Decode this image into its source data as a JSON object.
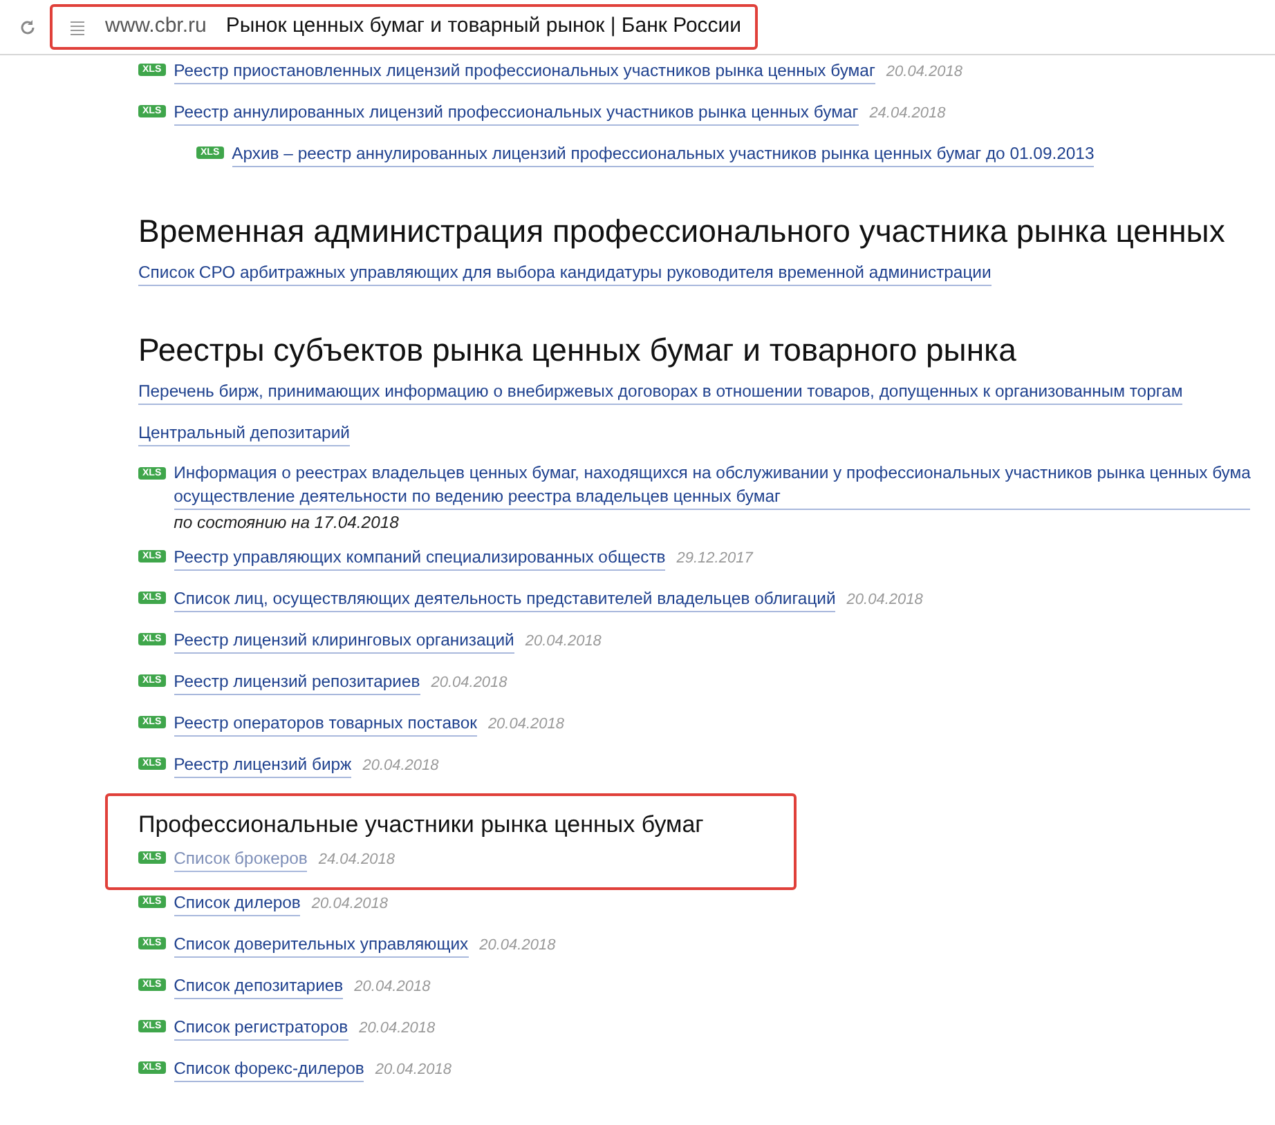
{
  "address_bar": {
    "url": "www.cbr.ru",
    "title": "Рынок ценных бумаг и товарный рынок | Банк России",
    "highlighted": true
  },
  "sections": [
    {
      "items": [
        {
          "kind": "xls",
          "badge": "XLS",
          "lines": [
            "Реестр приостановленных лицензий профессиональных участников рынка ценных бумаг"
          ],
          "date": "20.04.2018",
          "visited": false
        },
        {
          "kind": "xls",
          "badge": "XLS",
          "lines": [
            "Реестр аннулированных лицензий профессиональных участников рынка ценных бумаг"
          ],
          "date": "24.04.2018",
          "visited": false,
          "children": [
            {
              "kind": "xls",
              "badge": "XLS",
              "lines": [
                "Архив – реестр аннулированных лицензий профессиональных участников рынка ценных бумаг до 01.09.2013"
              ],
              "visited": false
            }
          ]
        }
      ]
    },
    {
      "heading": "Временная администрация профессионального участника рынка ценных",
      "kind": "major",
      "highlighted": false,
      "items": [
        {
          "kind": "link",
          "lines": [
            "Список СРО арбитражных управляющих для выбора кандидатуры руководителя временной администрации"
          ],
          "visited": false
        }
      ]
    },
    {
      "heading": "Реестры субъектов рынка ценных бумаг и товарного рынка",
      "kind": "major",
      "highlighted": false,
      "items": [
        {
          "kind": "link",
          "lines": [
            "Перечень бирж, принимающих информацию о внебиржевых договорах в отношении товаров, допущенных к организованным торгам"
          ],
          "visited": false
        },
        {
          "kind": "link",
          "lines": [
            "Центральный депозитарий"
          ],
          "visited": false
        },
        {
          "kind": "xls",
          "badge": "XLS",
          "lines": [
            "Информация о реестрах владельцев ценных бумаг, находящихся на обслуживании у профессиональных участников рынка ценных бума",
            "осуществление деятельности по ведению реестра владельцев ценных бумаг"
          ],
          "note": "по состоянию на 17.04.2018",
          "visited": false
        },
        {
          "kind": "xls",
          "badge": "XLS",
          "lines": [
            "Реестр управляющих компаний специализированных обществ"
          ],
          "date": "29.12.2017",
          "visited": false
        },
        {
          "kind": "xls",
          "badge": "XLS",
          "lines": [
            "Список лиц, осуществляющих деятельность представителей владельцев облигаций"
          ],
          "date": "20.04.2018",
          "visited": false
        },
        {
          "kind": "xls",
          "badge": "XLS",
          "lines": [
            "Реестр лицензий клиринговых организаций"
          ],
          "date": "20.04.2018",
          "visited": false
        },
        {
          "kind": "xls",
          "badge": "XLS",
          "lines": [
            "Реестр лицензий репозитариев"
          ],
          "date": "20.04.2018",
          "visited": false
        },
        {
          "kind": "xls",
          "badge": "XLS",
          "lines": [
            "Реестр операторов товарных поставок"
          ],
          "date": "20.04.2018",
          "visited": false
        },
        {
          "kind": "xls",
          "badge": "XLS",
          "lines": [
            "Реестр лицензий бирж"
          ],
          "date": "20.04.2018",
          "visited": false
        }
      ]
    },
    {
      "heading": "Профессиональные участники рынка ценных бумаг",
      "kind": "minor",
      "highlighted": true,
      "items": [
        {
          "kind": "xls",
          "badge": "XLS",
          "lines": [
            "Список брокеров"
          ],
          "date": "24.04.2018",
          "visited": true
        }
      ]
    },
    {
      "highlighted": false,
      "items": [
        {
          "kind": "xls",
          "badge": "XLS",
          "lines": [
            "Список дилеров"
          ],
          "date": "20.04.2018",
          "visited": false
        },
        {
          "kind": "xls",
          "badge": "XLS",
          "lines": [
            "Список доверительных управляющих"
          ],
          "date": "20.04.2018",
          "visited": false
        },
        {
          "kind": "xls",
          "badge": "XLS",
          "lines": [
            "Список депозитариев"
          ],
          "date": "20.04.2018",
          "visited": false
        },
        {
          "kind": "xls",
          "badge": "XLS",
          "lines": [
            "Список регистраторов"
          ],
          "date": "20.04.2018",
          "visited": false
        },
        {
          "kind": "xls",
          "badge": "XLS",
          "lines": [
            "Список форекс-дилеров"
          ],
          "date": "20.04.2018",
          "visited": false
        }
      ]
    }
  ]
}
